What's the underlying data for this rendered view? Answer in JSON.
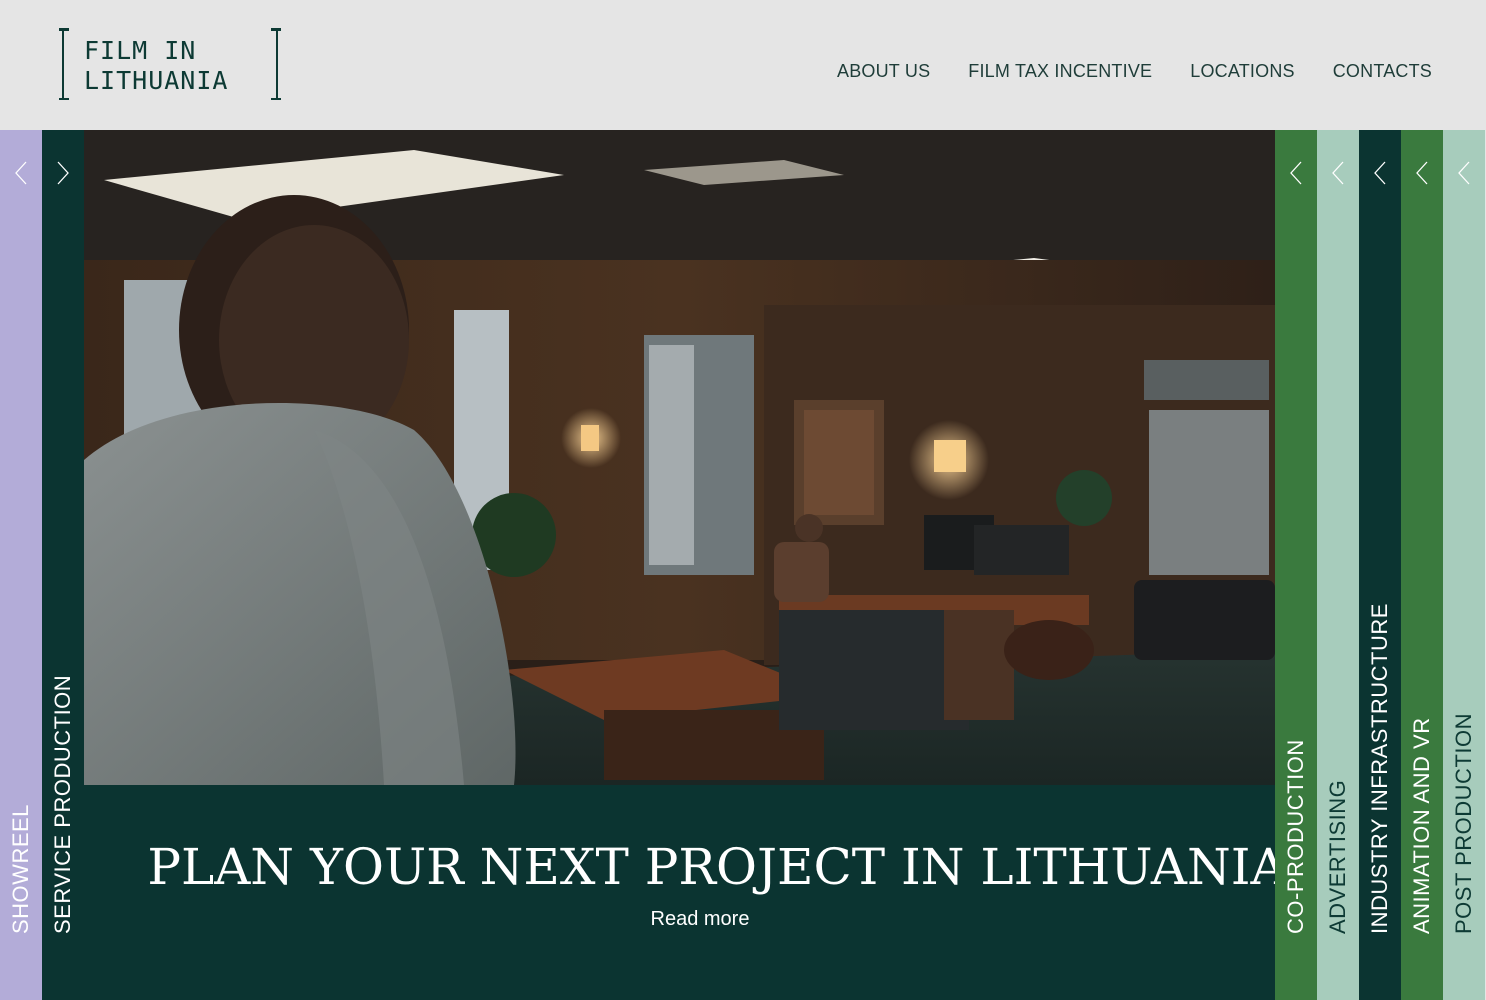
{
  "logo": {
    "line1": "FILM IN",
    "line2": "LITHUANIA"
  },
  "nav": {
    "items": [
      {
        "label": "ABOUT US"
      },
      {
        "label": "FILM TAX INCENTIVE"
      },
      {
        "label": "LOCATIONS"
      },
      {
        "label": "CONTACTS"
      }
    ]
  },
  "left_strips": [
    {
      "label": "SHOWREEL",
      "color": "#b3acd8",
      "arrow": "left"
    },
    {
      "label": "SERVICE PRODUCTION",
      "color": "#0b3431",
      "arrow": "right"
    }
  ],
  "right_strips": [
    {
      "label": "CO-PRODUCTION",
      "color": "#3a7a3e",
      "arrow": "left"
    },
    {
      "label": "ADVERTISING",
      "color": "#a7ccbc",
      "arrow": "left"
    },
    {
      "label": "INDUSTRY INFRASTRUCTURE",
      "color": "#0b3431",
      "arrow": "left"
    },
    {
      "label": "ANIMATION AND VR",
      "color": "#3a7a3e",
      "arrow": "left"
    },
    {
      "label": "POST PRODUCTION",
      "color": "#a7ccbc",
      "arrow": "left"
    }
  ],
  "hero": {
    "title": "PLAN YOUR NEXT PROJECT IN LITHUANIA",
    "read_more": "Read more"
  },
  "colors": {
    "header_bg": "#e5e5e5",
    "brand_dark": "#0b3431",
    "green": "#3a7a3e",
    "mint": "#a7ccbc",
    "lavender": "#b3acd8"
  }
}
